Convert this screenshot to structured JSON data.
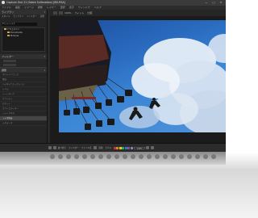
{
  "window": {
    "title": "Capture One 21 (Sabre Sulfonation) [BD-RSA]",
    "controls": [
      "—",
      "□",
      "✕"
    ]
  },
  "menu": [
    "ファイル",
    "編集",
    "イメージ",
    "調整",
    "レイヤー",
    "選択",
    "表示",
    "ウィンドウ",
    "ヘルプ"
  ],
  "left_panel": {
    "library_header": "ライブラリ",
    "tools": [
      "スタイル",
      "ライブラリ",
      "フィルター",
      "調整"
    ],
    "path": "E:\\フォト\\スケ"
  },
  "folders": [
    {
      "name": "ドキュメント"
    },
    {
      "name": "Documents"
    },
    {
      "name": "Pictures"
    }
  ],
  "filters_header": "フィルター",
  "adjust_header": "調整",
  "list_rows": [
    {
      "label": "ホワイトバランス",
      "selected": false
    },
    {
      "label": "露出",
      "selected": false
    },
    {
      "label": "ハイダイナミックレンジ",
      "selected": false
    },
    {
      "label": "レベル",
      "selected": false
    },
    {
      "label": "トーンカーブ",
      "selected": false
    },
    {
      "label": "クラリティ",
      "selected": false
    },
    {
      "label": "ビネット",
      "selected": false
    },
    {
      "label": "カラーエディター",
      "selected": false
    },
    {
      "label": "シャープネス",
      "selected": false
    },
    {
      "label": "ノイズ除去",
      "selected": true
    },
    {
      "label": "メタデータ",
      "selected": false
    }
  ],
  "viewer_toolbar": {
    "items": [
      "100%",
      "フィット",
      "比較"
    ],
    "zoom": "100%"
  },
  "bottom_bar": {
    "labels": [
      "並べ替え",
      "フィルター",
      "ファイル名",
      "評価",
      "ラベル"
    ],
    "zoom_value": "100%",
    "color_chips": [
      "#c0392b",
      "#e67e22",
      "#f1c40f",
      "#27ae60",
      "#2980b9",
      "#8e44ad",
      "#7f8c8d"
    ]
  }
}
